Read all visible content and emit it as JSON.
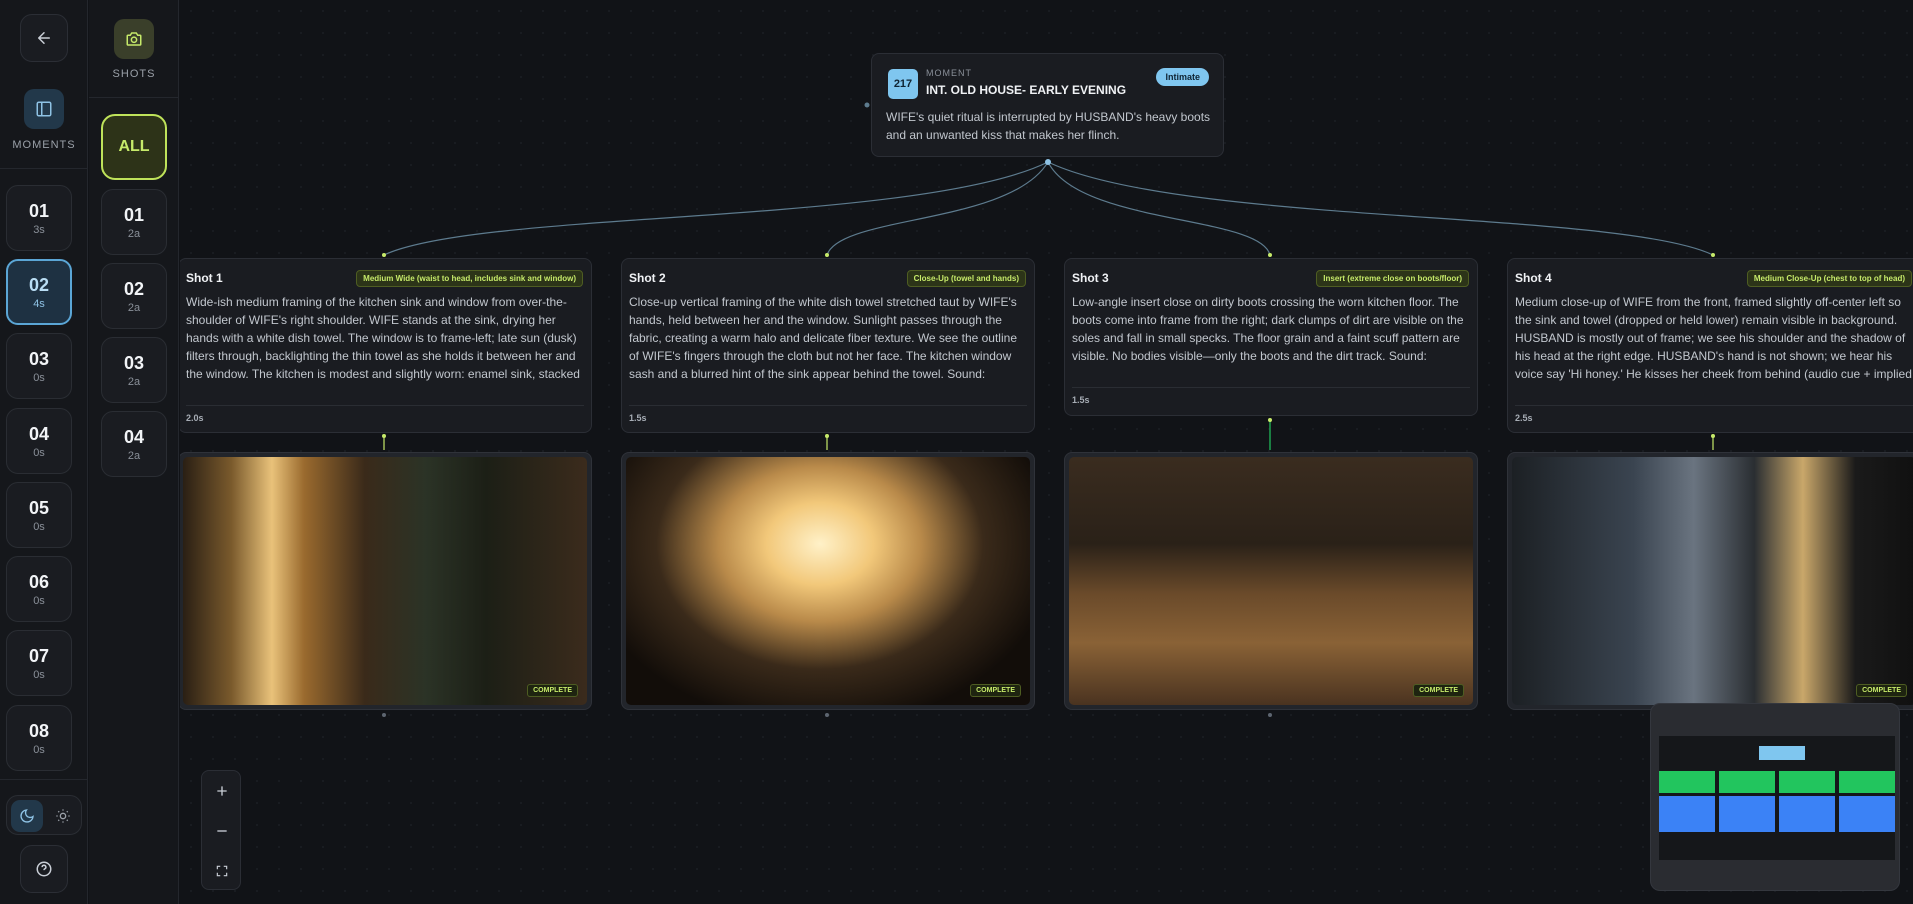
{
  "nav": {
    "back_icon": "arrow-left-icon",
    "moments_label": "MOMENTS",
    "shots_label": "SHOTS"
  },
  "moments": [
    {
      "num": "01",
      "dur": "3s"
    },
    {
      "num": "02",
      "dur": "4s",
      "active": true
    },
    {
      "num": "03",
      "dur": "0s"
    },
    {
      "num": "04",
      "dur": "0s"
    },
    {
      "num": "05",
      "dur": "0s"
    },
    {
      "num": "06",
      "dur": "0s"
    },
    {
      "num": "07",
      "dur": "0s"
    },
    {
      "num": "08",
      "dur": "0s"
    }
  ],
  "shots_filter": {
    "all_label": "ALL",
    "items": [
      {
        "num": "01",
        "dur": "2a"
      },
      {
        "num": "02",
        "dur": "2a"
      },
      {
        "num": "03",
        "dur": "2a"
      },
      {
        "num": "04",
        "dur": "2a"
      }
    ]
  },
  "moment_node": {
    "number": "217",
    "kicker": "MOMENT",
    "title": "INT. OLD HOUSE- EARLY EVENING",
    "tag": "Intimate",
    "description": "WIFE's quiet ritual is interrupted by HUSBAND's heavy boots and an unwanted kiss that makes her flinch."
  },
  "shots": [
    {
      "title": "Shot 1",
      "tag": "Medium Wide (waist to head, includes sink and window)",
      "description": "Wide-ish medium framing of the kitchen sink and window from over-the-shoulder of WIFE's right shoulder. WIFE stands at the sink, drying her hands with a white dish towel. The window is to frame-left; late sun (dusk) filters through, backlighting the thin towel as she holds it between her and the window. The kitchen is modest and slightly worn: enamel sink, stacked plates, a wooden table partially visible. The towel is translucent in the…",
      "duration": "2.0s",
      "status": "COMPLETE"
    },
    {
      "title": "Shot 2",
      "tag": "Close-Up (towel and hands)",
      "description": "Close-up vertical framing of the white dish towel stretched taut by WIFE's hands, held between her and the window. Sunlight passes through the fabric, creating a warm halo and delicate fiber texture. We see the outline of WIFE's fingers through the cloth but not her face. The kitchen window sash and a blurred hint of the sink appear behind the towel. Sound: humming continues; faint creak of floorboards far off.",
      "duration": "1.5s",
      "status": "COMPLETE"
    },
    {
      "title": "Shot 3",
      "tag": "Insert (extreme close on boots/floor)",
      "description": "Low-angle insert close on dirty boots crossing the worn kitchen floor. The boots come into frame from the right; dark clumps of dirt are visible on the soles and fall in small specks. The floor grain and a faint scuff pattern are visible. No bodies visible—only the boots and the dirt track. Sound: amplified heavy boot steps and a soft door thud; humming cuts subtly.",
      "duration": "1.5s",
      "status": "COMPLETE"
    },
    {
      "title": "Shot 4",
      "tag": "Medium Close-Up (chest to top of head)",
      "description": "Medium close-up of WIFE from the front, framed slightly off-center left so the sink and towel (dropped or held lower) remain visible in background. HUSBAND is mostly out of frame; we see his shoulder and the shadow of his head at the right edge. HUSBAND's hand is not shown; we hear his voice say 'Hi honey.' He kisses her cheek from behind (audio cue + implied contact); WIFE's face registers a tiny involuntary shrink — eyes flick,…",
      "duration": "2.5s",
      "status": "COMPLETE"
    }
  ],
  "colors": {
    "accent_blue": "#7fc6ef",
    "accent_lime": "#c6ea6a",
    "minimap_green": "#22c55e",
    "minimap_blue": "#3b82f6"
  }
}
